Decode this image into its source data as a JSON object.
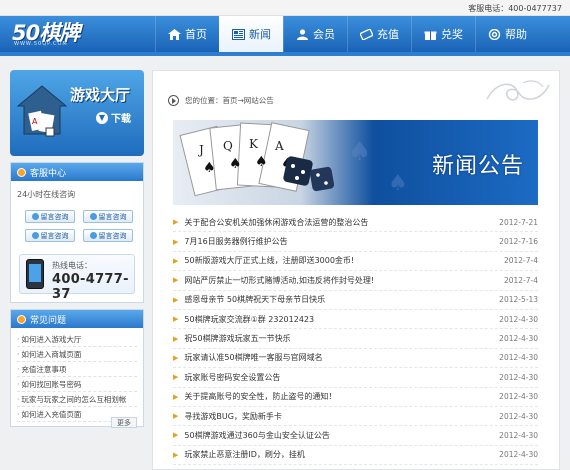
{
  "header": {
    "hotline": "客服电话：400-0477737",
    "logo_main": "50棋牌",
    "logo_sub": "WWW.50QP.COM"
  },
  "nav": [
    {
      "label": "首页",
      "icon": "home-icon"
    },
    {
      "label": "新闻",
      "icon": "newspaper-icon"
    },
    {
      "label": "会员",
      "icon": "user-icon"
    },
    {
      "label": "充值",
      "icon": "card-icon"
    },
    {
      "label": "兑奖",
      "icon": "gift-icon"
    },
    {
      "label": "帮助",
      "icon": "help-icon"
    }
  ],
  "sidebar": {
    "hall_title": "游戏大厅",
    "hall_download": "下载",
    "service_title": "客服中心",
    "service_sub": "24小时在线咨询",
    "consult_buttons": [
      "留言咨询",
      "留言咨询",
      "留言咨询",
      "留言咨询"
    ],
    "phone_label": "热线电话：",
    "phone_number": "400-4777-37",
    "faq_title": "常见问题",
    "faq_items": [
      "如何进入游戏大厅",
      "如何进入商城页面",
      "充值注意事项",
      "如何找回账号密码",
      "玩家与玩家之间的怎么互相划帐",
      "如何进入充值页面"
    ],
    "more_label": "更多"
  },
  "main": {
    "breadcrumb": "您的位置：首页→网站公告",
    "banner_title": "新闻公告",
    "news": [
      {
        "title": "关于配合公安机关加强休闲游戏合法运营的整治公告",
        "date": "2012-7-21"
      },
      {
        "title": "7月16日服务器例行维护公告",
        "date": "2012-7-16"
      },
      {
        "title": "50新版游戏大厅正式上线，注册即送3000金币!",
        "date": "2012-7-4"
      },
      {
        "title": "网站严厉禁止一切形式赌博活动,如违反将作封号处理!",
        "date": "2012-7-4"
      },
      {
        "title": "感恩母亲节 50棋牌祝天下母亲节日快乐",
        "date": "2012-5-13"
      },
      {
        "title": "50棋牌玩家交流群①群 232012423",
        "date": "2012-4-30"
      },
      {
        "title": "祝50棋牌游戏玩家五一节快乐",
        "date": "2012-4-30"
      },
      {
        "title": "玩家请认准50棋牌唯一客服与官网域名",
        "date": "2012-4-30"
      },
      {
        "title": "玩家账号密码安全设置公告",
        "date": "2012-4-30"
      },
      {
        "title": "关于提高账号的安全性，防止盗号的通知！",
        "date": "2012-4-30"
      },
      {
        "title": "寻找游戏BUG，奖励新手卡",
        "date": "2012-4-30"
      },
      {
        "title": "50棋牌游戏通过360与金山安全认证公告",
        "date": "2012-4-30"
      },
      {
        "title": "玩家禁止恶意注册ID，刷分，挂机",
        "date": "2012-4-30"
      }
    ]
  }
}
